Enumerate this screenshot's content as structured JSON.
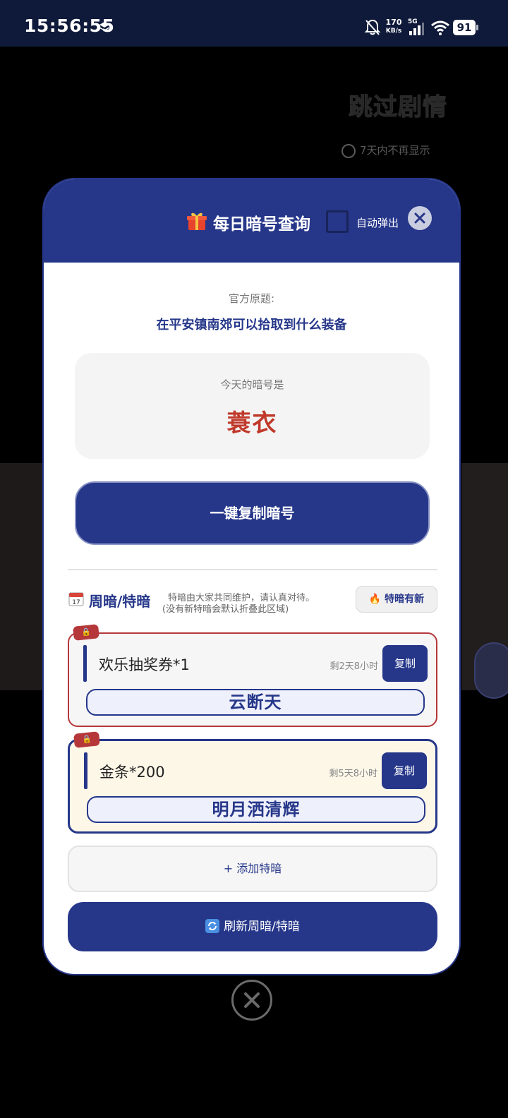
{
  "status_bar": {
    "time": "15:56:55",
    "net_speed_value": "170",
    "net_speed_unit": "KB/s",
    "network": "5G",
    "battery": "91"
  },
  "background": {
    "skip_story": "跳过剧情",
    "no_show_7days": "7天内不再显示"
  },
  "modal": {
    "title": "每日暗号查询",
    "auto_popup_label": "自动弹出",
    "question_label": "官方原题:",
    "question_text": "在平安镇南郊可以拾取到什么装备",
    "code_label": "今天的暗号是",
    "code_value": "蓑衣",
    "copy_code_button": "一键复制暗号",
    "weekly": {
      "title": "周暗/特暗",
      "note_line1": "特暗由大家共同维护，请认真对待。",
      "note_line2": "(没有新特暗会默认折叠此区域)",
      "new_button": "特暗有新"
    },
    "cards": [
      {
        "title": "欢乐抽奖券*1",
        "remaining": "剩2天8小时",
        "copy": "复制",
        "code": "云断天"
      },
      {
        "title": "金条*200",
        "remaining": "剩5天8小时",
        "copy": "复制",
        "code": "明月洒清辉"
      }
    ],
    "add_button": "+ 添加特暗",
    "refresh_button": "刷新周暗/特暗"
  },
  "colors": {
    "primary": "#26378a",
    "accent_red": "#c0392b",
    "status_bar_bg": "#0f1a3a"
  }
}
